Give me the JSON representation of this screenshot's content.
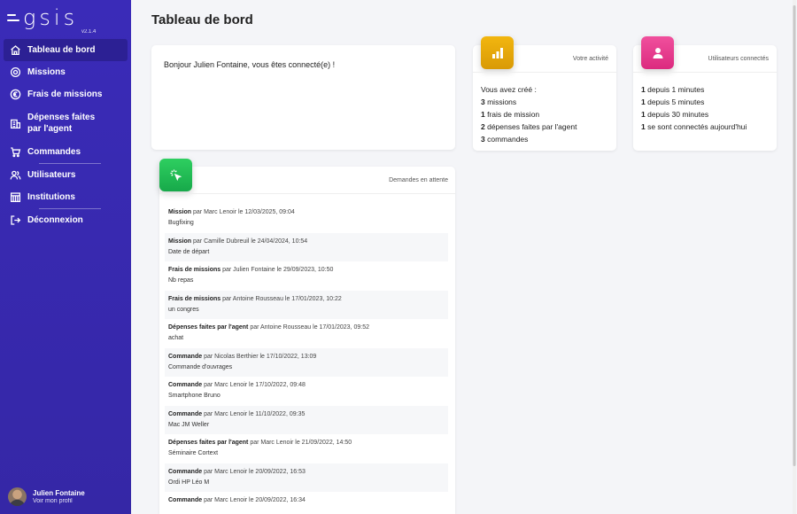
{
  "brand": {
    "name": "gsis",
    "version": "v2.1.4"
  },
  "sidebar": {
    "items": [
      {
        "label": "Tableau de bord",
        "icon": "home-icon"
      },
      {
        "label": "Missions",
        "icon": "target-icon"
      },
      {
        "label": "Frais de missions",
        "icon": "euro-icon"
      },
      {
        "label": "Dépenses faites\npar l'agent",
        "icon": "building-icon"
      },
      {
        "label": "Commandes",
        "icon": "cart-icon"
      },
      {
        "label": "Utilisateurs",
        "icon": "users-icon"
      },
      {
        "label": "Institutions",
        "icon": "institution-icon"
      },
      {
        "label": "Déconnexion",
        "icon": "logout-icon"
      }
    ],
    "profile": {
      "name": "Julien Fontaine",
      "link": "Voir mon profil"
    }
  },
  "page": {
    "title": "Tableau de bord"
  },
  "welcome": {
    "message": "Bonjour Julien Fontaine, vous êtes connecté(e) !"
  },
  "activity": {
    "header": "Votre activité",
    "icon": "bar-chart-icon",
    "intro": "Vous avez créé :",
    "lines": [
      {
        "count": "3",
        "text": " missions"
      },
      {
        "count": "1",
        "text": " frais de mission"
      },
      {
        "count": "2",
        "text": " dépenses faites par l'agent"
      },
      {
        "count": "3",
        "text": " commandes"
      }
    ]
  },
  "connected": {
    "header": "Utilisateurs connectés",
    "icon": "user-icon",
    "lines": [
      {
        "count": "1",
        "text": " depuis 1 minutes"
      },
      {
        "count": "1",
        "text": " depuis 5 minutes"
      },
      {
        "count": "1",
        "text": " depuis 30 minutes"
      },
      {
        "count": "1",
        "text": " se sont connectés aujourd'hui"
      }
    ]
  },
  "pending": {
    "header": "Demandes en attente",
    "icon": "pointer-click-icon",
    "requests": [
      {
        "type": "Mission",
        "meta": " par Marc Lenoir le 12/03/2025, 09:04",
        "detail": "Bugfixing"
      },
      {
        "type": "Mission",
        "meta": " par Camille Dubreuil le 24/04/2024, 10:54",
        "detail": "Date de départ"
      },
      {
        "type": "Frais de missions",
        "meta": " par Julien Fontaine le 29/09/2023, 10:50",
        "detail": "Nb repas"
      },
      {
        "type": "Frais de missions",
        "meta": " par Antoine Rousseau le 17/01/2023, 10:22",
        "detail": "un congres"
      },
      {
        "type": "Dépenses faites par l'agent",
        "meta": " par Antoine Rousseau le 17/01/2023, 09:52",
        "detail": "achat"
      },
      {
        "type": "Commande",
        "meta": " par Nicolas Berthier le 17/10/2022, 13:09",
        "detail": "Commande d'ouvrages"
      },
      {
        "type": "Commande",
        "meta": " par Marc Lenoir le 17/10/2022, 09:48",
        "detail": "Smartphone Bruno"
      },
      {
        "type": "Commande",
        "meta": " par Marc Lenoir le 11/10/2022, 09:35",
        "detail": "Mac JM Weller"
      },
      {
        "type": "Dépenses faites par l'agent",
        "meta": " par Marc Lenoir le 21/09/2022, 14:50",
        "detail": "Séminaire Cortext"
      },
      {
        "type": "Commande",
        "meta": " par Marc Lenoir le 20/09/2022, 16:53",
        "detail": "Ordi HP Léo M"
      },
      {
        "type": "Commande",
        "meta": " par Marc Lenoir le 20/09/2022, 16:34",
        "detail": ""
      }
    ]
  }
}
